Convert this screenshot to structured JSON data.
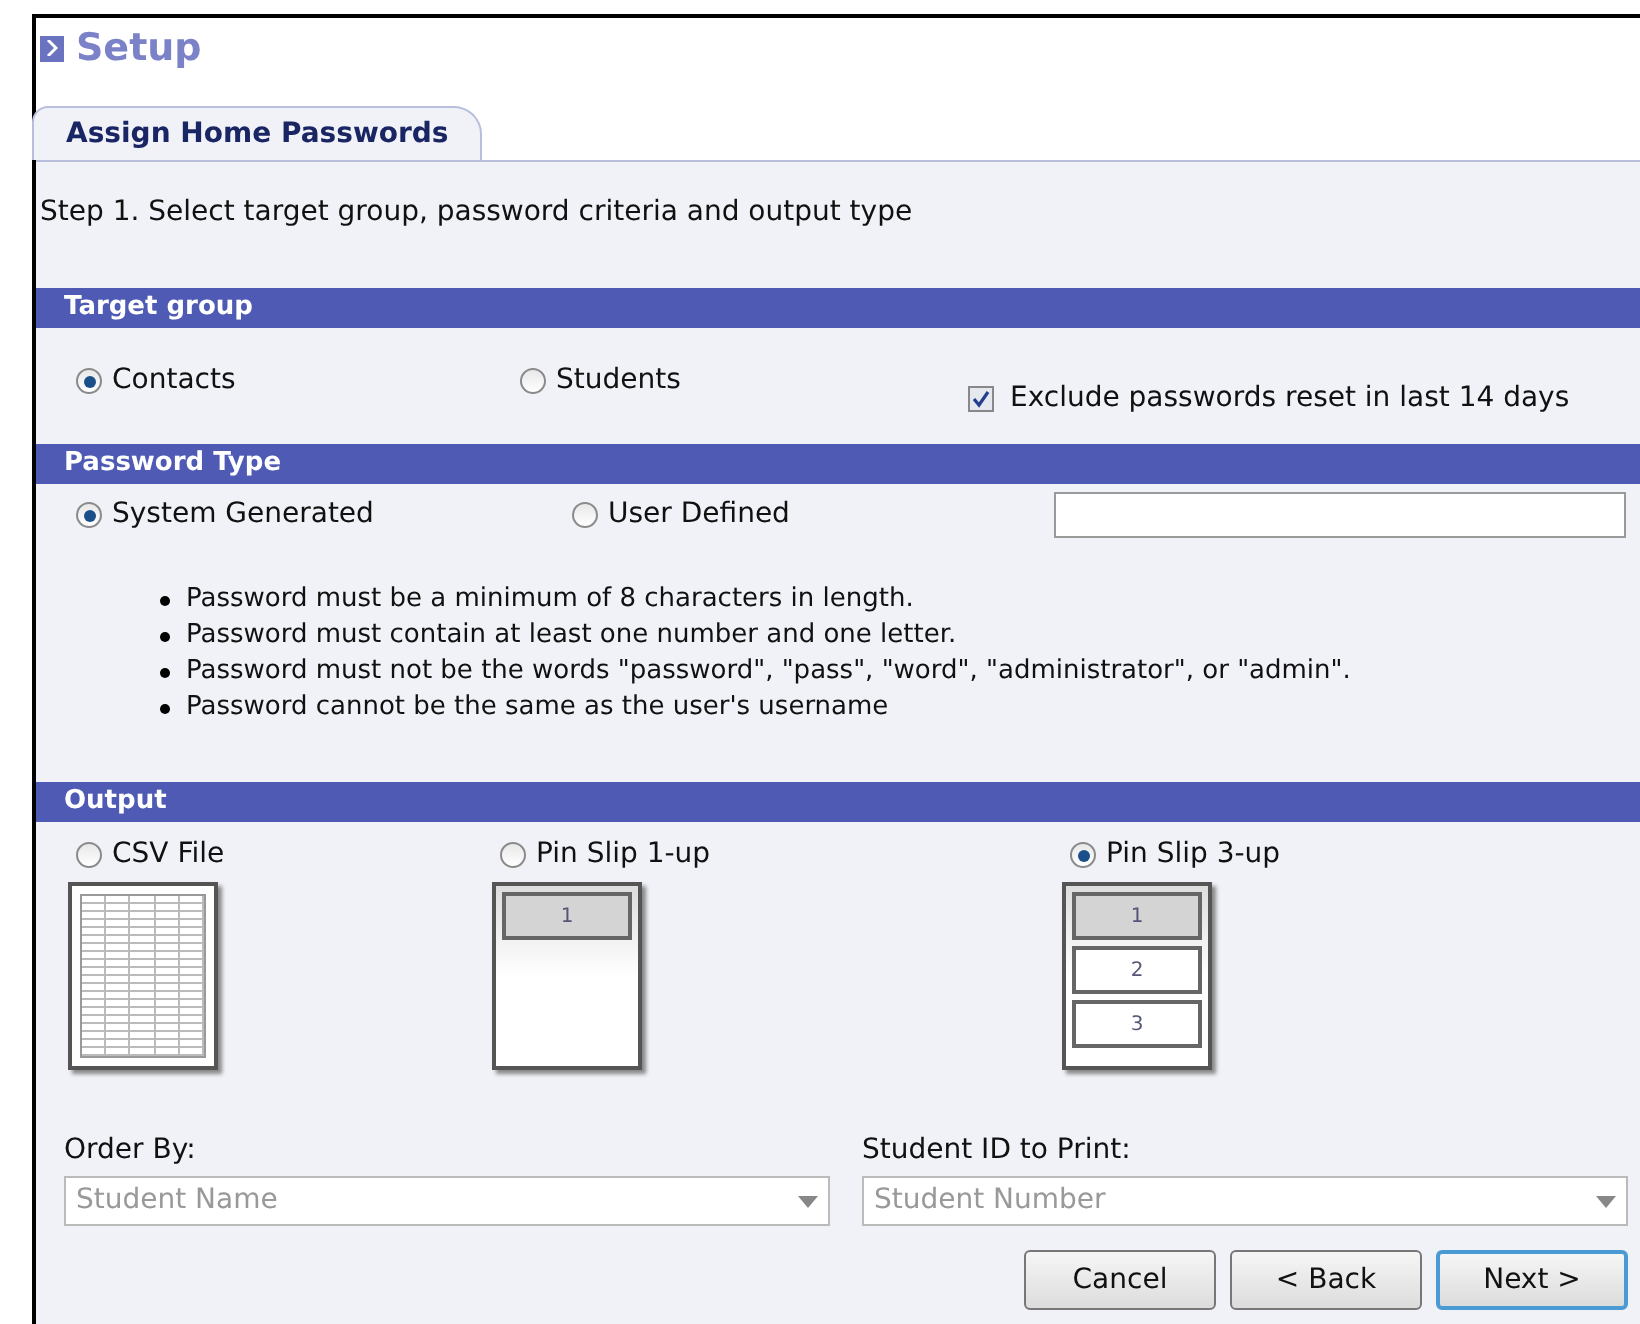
{
  "header": {
    "title": "Setup"
  },
  "tabs": [
    {
      "label": "Assign Home Passwords",
      "selected": true
    }
  ],
  "step_text": "Step 1. Select target group, password criteria and output type",
  "target_group": {
    "title": "Target group",
    "options": [
      {
        "label": "Contacts",
        "selected": true
      },
      {
        "label": "Students",
        "selected": false
      }
    ],
    "exclude": {
      "label": "Exclude passwords reset in last 14 days",
      "checked": true
    }
  },
  "password_type": {
    "title": "Password Type",
    "options": [
      {
        "label": "System Generated",
        "selected": true
      },
      {
        "label": "User Defined",
        "selected": false
      }
    ],
    "rules": [
      "Password must be a minimum of 8 characters in length.",
      "Password must contain at least one number and one letter.",
      "Password must not be the words \"password\", \"pass\", \"word\", \"administrator\", or \"admin\".",
      "Password cannot be the same as the user's username"
    ]
  },
  "output": {
    "title": "Output",
    "options": [
      {
        "label": "CSV File",
        "selected": false,
        "kind": "csv"
      },
      {
        "label": "Pin Slip 1-up",
        "selected": false,
        "kind": "slips",
        "slots": [
          "1"
        ]
      },
      {
        "label": "Pin Slip 3-up",
        "selected": true,
        "kind": "slips",
        "slots": [
          "1",
          "2",
          "3"
        ]
      }
    ]
  },
  "order_by": {
    "label": "Order By:",
    "value": "Student Name",
    "disabled": true
  },
  "student_id": {
    "label": "Student ID to Print:",
    "value": "Student Number",
    "disabled": true
  },
  "buttons": [
    {
      "label": "Cancel",
      "default": false
    },
    {
      "label": "< Back",
      "default": false
    },
    {
      "label": "Next >",
      "default": true
    }
  ]
}
